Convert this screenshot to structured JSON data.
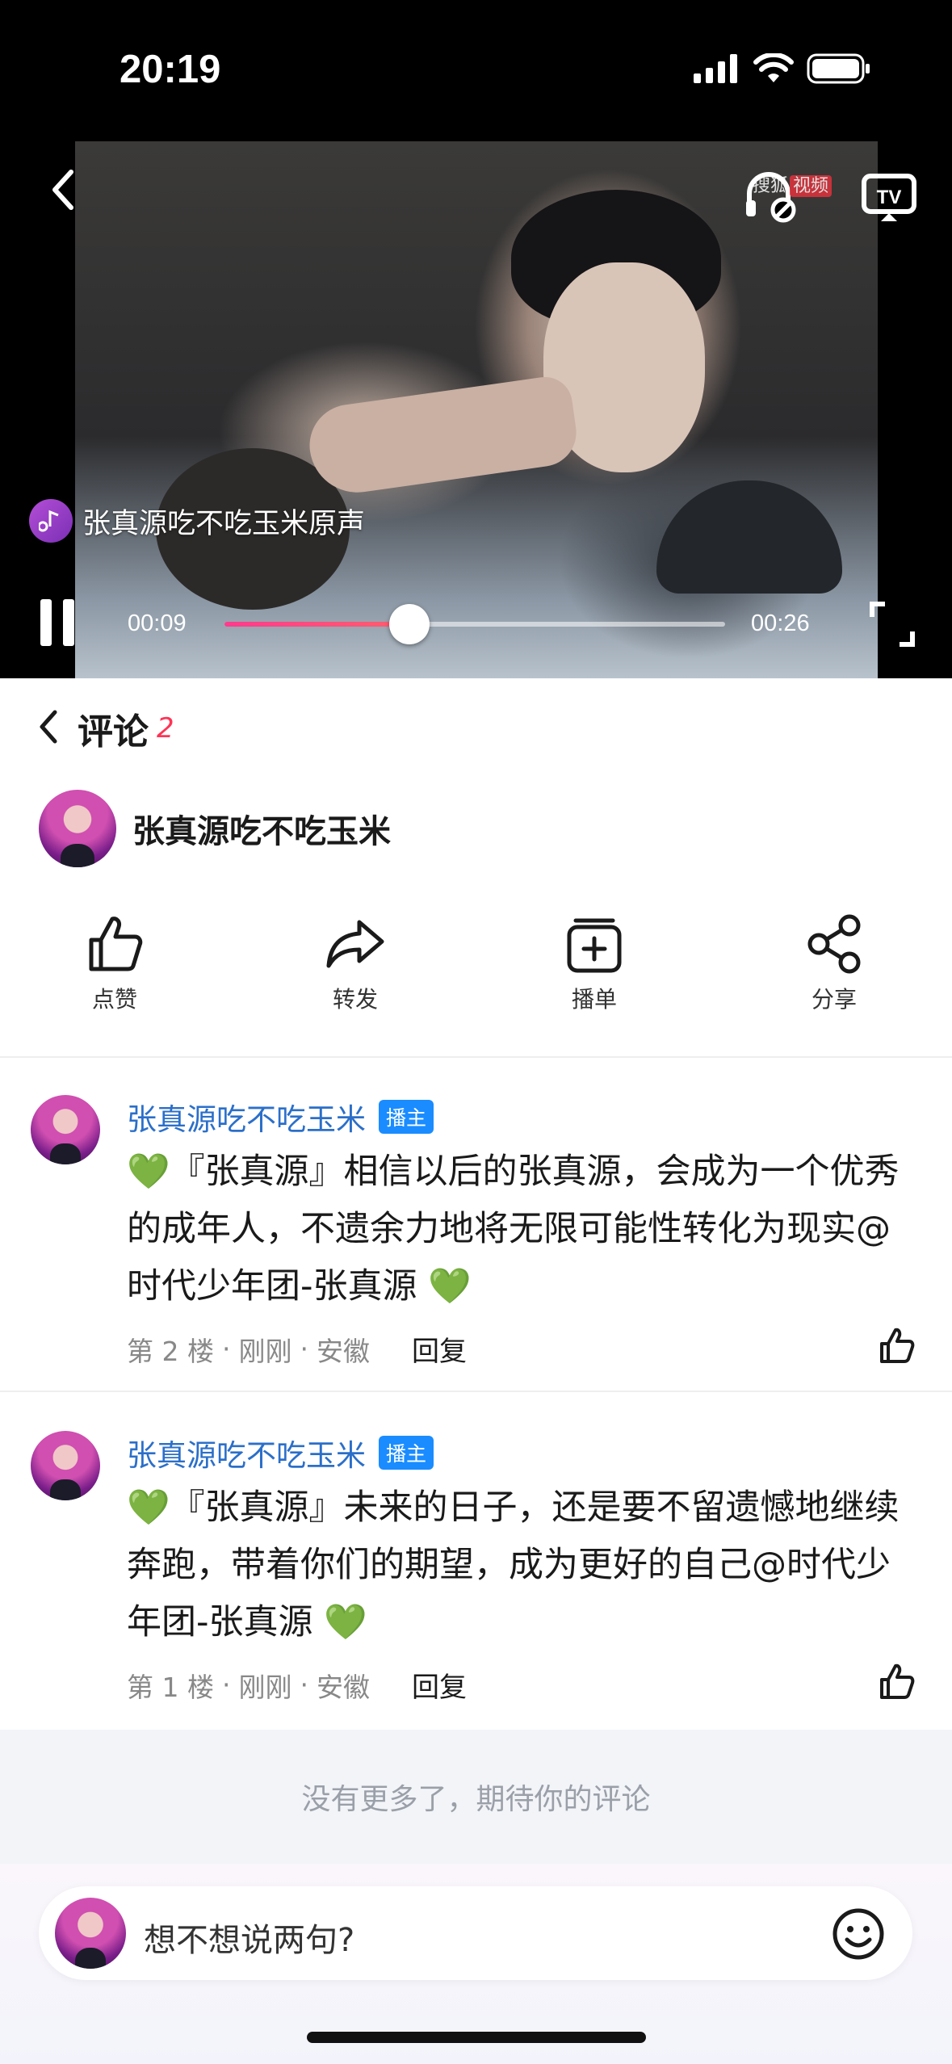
{
  "status_bar": {
    "time": "20:19"
  },
  "video": {
    "brand_text": "搜狐",
    "brand_badge": "视频",
    "sound_label": "张真源吃不吃玉米原声",
    "current_time": "00:09",
    "total_time": "00:26",
    "progress": 0.37,
    "progress_color": "#ff3b8d"
  },
  "comments_header": {
    "title": "评论",
    "count": "2"
  },
  "author": {
    "name": "张真源吃不吃玉米"
  },
  "actions": [
    {
      "label": "点赞",
      "icon": "thumb-up-icon"
    },
    {
      "label": "转发",
      "icon": "forward-icon"
    },
    {
      "label": "播单",
      "icon": "playlist-add-icon"
    },
    {
      "label": "分享",
      "icon": "share-icon"
    }
  ],
  "comments": [
    {
      "user": "张真源吃不吃玉米",
      "tag": "播主",
      "text": "💚『张真源』相信以后的张真源，会成为一个优秀的成年人，不遗余力地将无限可能性转化为现实@时代少年团-张真源 💚",
      "floor": "第 2 楼",
      "time": "刚刚",
      "location": "安徽",
      "reply_label": "回复"
    },
    {
      "user": "张真源吃不吃玉米",
      "tag": "播主",
      "text": "💚『张真源』未来的日子，还是要不留遗憾地继续奔跑，带着你们的期望，成为更好的自己@时代少年团-张真源 💚",
      "floor": "第 1 楼",
      "time": "刚刚",
      "location": "安徽",
      "reply_label": "回复"
    }
  ],
  "no_more_text": "没有更多了，期待你的评论",
  "input": {
    "placeholder": "想不想说两句?"
  },
  "meta_separator": "·",
  "colors": {
    "accent_blue": "#2b6fc9",
    "badge_blue": "#1a8cff",
    "count_red": "#ff3355"
  }
}
